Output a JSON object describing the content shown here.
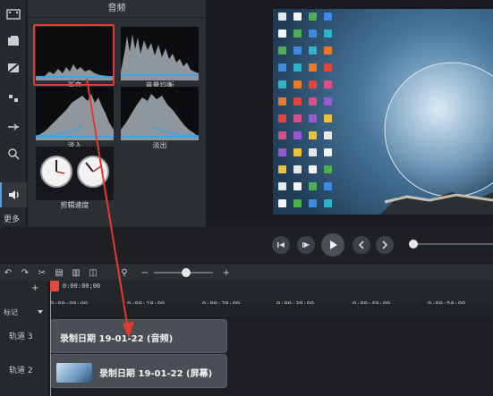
{
  "panel": {
    "title": "音频"
  },
  "effects": [
    {
      "label": "渐变",
      "icon": "fade-waveform"
    },
    {
      "label": "音量均衡",
      "icon": "volume-leveling-waveform"
    },
    {
      "label": "淡入",
      "icon": "fade-in-waveform"
    },
    {
      "label": "淡出",
      "icon": "fade-out-waveform"
    },
    {
      "label": "剪辑速度",
      "icon": "clip-speed-clocks"
    }
  ],
  "rail": {
    "more": "更多"
  },
  "timeline": {
    "playhead_time": "0:00:00;00",
    "marker_label": "标记",
    "ticks": [
      "0:00:00;00",
      "0:00:10;00",
      "0:00:20;00",
      "0:00:30;00",
      "0:00:40;00",
      "0:00:50;00"
    ],
    "tracks": [
      {
        "label": "轨道 3",
        "clip": "录制日期 19-01-22 (音频)"
      },
      {
        "label": "轨道 2",
        "clip": "录制日期 19-01-22 (屏幕)"
      }
    ]
  },
  "colors": {
    "accent": "#4ea3e8",
    "selection": "#e23a2e",
    "arrow": "#e23a2e"
  }
}
